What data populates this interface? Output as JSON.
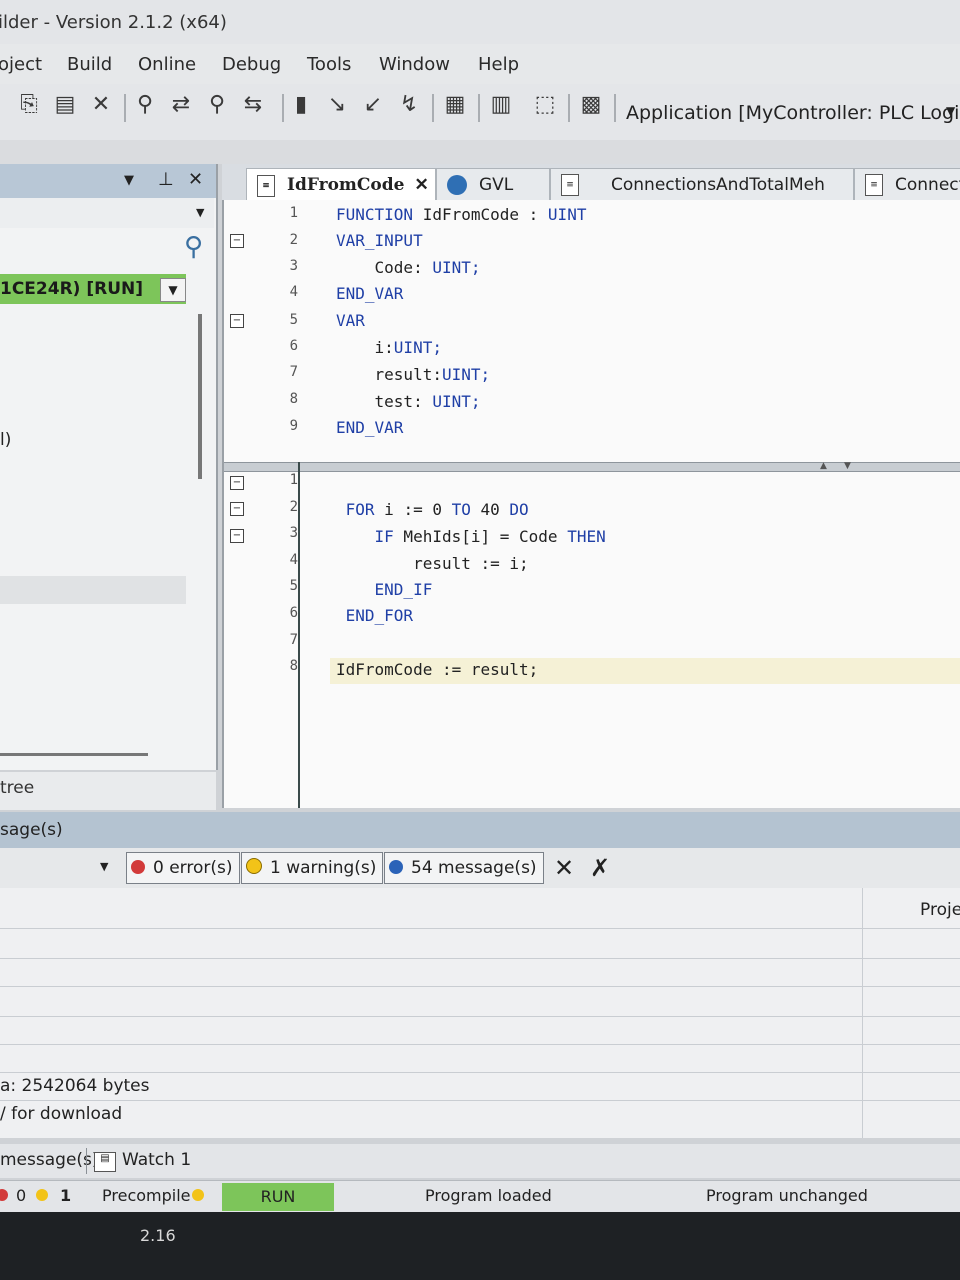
{
  "window": {
    "title": "ilder - Version 2.1.2 (x64)"
  },
  "menu": [
    "oject",
    "Build",
    "Online",
    "Debug",
    "Tools",
    "Window",
    "Help"
  ],
  "toolbar": {
    "application_target": "Application [MyController: PLC Logic]"
  },
  "left_pane": {
    "device_node": "1CE24R) [RUN]",
    "node2": "l)",
    "footer": "tree"
  },
  "editor": {
    "tabs": [
      {
        "label": "IdFromCode",
        "active": true
      },
      {
        "label": "GVL"
      },
      {
        "label": "ConnectionsAndTotalMeh"
      },
      {
        "label": "Connect"
      }
    ],
    "declaration": [
      {
        "ln": "1",
        "code": "FUNCTION IdFromCode : UINT"
      },
      {
        "ln": "2",
        "code": "VAR_INPUT"
      },
      {
        "ln": "3",
        "code": "    Code: UINT;"
      },
      {
        "ln": "4",
        "code": "END_VAR"
      },
      {
        "ln": "5",
        "code": "VAR"
      },
      {
        "ln": "6",
        "code": "    i:UINT;"
      },
      {
        "ln": "7",
        "code": "    result:UINT;"
      },
      {
        "ln": "8",
        "code": "    test: UINT;"
      },
      {
        "ln": "9",
        "code": "END_VAR"
      }
    ],
    "body": [
      {
        "ln": "1",
        "code": ""
      },
      {
        "ln": "2",
        "code": " FOR i := 0 TO 40 DO"
      },
      {
        "ln": "3",
        "code": "    IF MehIds[i] = Code THEN"
      },
      {
        "ln": "4",
        "code": "        result := i;"
      },
      {
        "ln": "5",
        "code": "    END_IF"
      },
      {
        "ln": "6",
        "code": " END_FOR"
      },
      {
        "ln": "7",
        "code": ""
      },
      {
        "ln": "8",
        "code": "IdFromCode := result;"
      }
    ]
  },
  "messages": {
    "header": "sage(s)",
    "errors": "0 error(s)",
    "warnings": "1 warning(s)",
    "infos": "54 message(s)",
    "column_project": "Proje",
    "line1": "a: 2542064 bytes",
    "line2": "/ for download"
  },
  "bottom_tabs": [
    "message(s)",
    "Watch 1"
  ],
  "status": {
    "err_count": "0",
    "warn_count": "1",
    "precompile": "Precompile",
    "run": "RUN",
    "program_loaded": "Program loaded",
    "program_unchanged": "Program unchanged"
  },
  "taskbar": {
    "text": "2.16"
  },
  "colors": {
    "run_green": "#7dc55a",
    "keyword_blue": "#1f3fa6",
    "panel_header": "#b8c7d6"
  }
}
